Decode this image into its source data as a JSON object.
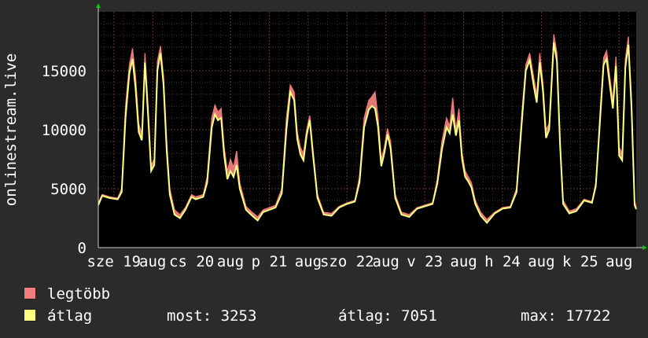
{
  "chart_data": {
    "type": "area",
    "ylabel": "onlinestream.live",
    "ylim": [
      0,
      20000
    ],
    "yticks": [
      0,
      5000,
      10000,
      15000
    ],
    "grid": true,
    "x_tick_labels": [
      {
        "label": "sze 19",
        "day": 0
      },
      {
        "label": "aug",
        "day": 0.5
      },
      {
        "label": "cs 20",
        "day": 1
      },
      {
        "label": "aug",
        "day": 1.5
      },
      {
        "label": "p 21",
        "day": 2
      },
      {
        "label": "aug",
        "day": 2.5
      },
      {
        "label": "szo 22",
        "day": 3
      },
      {
        "label": "aug",
        "day": 3.5
      },
      {
        "label": "v 23",
        "day": 4
      },
      {
        "label": "aug",
        "day": 4.5
      },
      {
        "label": "h 24",
        "day": 5
      },
      {
        "label": "aug",
        "day": 5.5
      },
      {
        "label": "k 25",
        "day": 6
      },
      {
        "label": "aug",
        "day": 6.5
      }
    ],
    "x_range_days": [
      -0.2,
      6.72
    ],
    "series": [
      {
        "name": "legtöbb",
        "color": "#f07c7c",
        "points": [
          [
            -0.2,
            3800
          ],
          [
            -0.15,
            4500
          ],
          [
            -0.05,
            4300
          ],
          [
            0.05,
            4200
          ],
          [
            0.1,
            5000
          ],
          [
            0.15,
            12000
          ],
          [
            0.2,
            15500
          ],
          [
            0.24,
            16900
          ],
          [
            0.28,
            14500
          ],
          [
            0.32,
            10500
          ],
          [
            0.36,
            9700
          ],
          [
            0.4,
            16500
          ],
          [
            0.44,
            12000
          ],
          [
            0.48,
            7000
          ],
          [
            0.52,
            7500
          ],
          [
            0.56,
            15800
          ],
          [
            0.6,
            17100
          ],
          [
            0.64,
            14500
          ],
          [
            0.68,
            9000
          ],
          [
            0.72,
            5000
          ],
          [
            0.78,
            3200
          ],
          [
            0.85,
            2800
          ],
          [
            0.92,
            3400
          ],
          [
            1.0,
            4500
          ],
          [
            1.05,
            4300
          ],
          [
            1.15,
            4500
          ],
          [
            1.2,
            6000
          ],
          [
            1.26,
            11000
          ],
          [
            1.3,
            12100
          ],
          [
            1.34,
            11500
          ],
          [
            1.38,
            11800
          ],
          [
            1.42,
            8500
          ],
          [
            1.46,
            6500
          ],
          [
            1.5,
            7500
          ],
          [
            1.54,
            6800
          ],
          [
            1.58,
            8200
          ],
          [
            1.62,
            5500
          ],
          [
            1.7,
            3500
          ],
          [
            1.78,
            3000
          ],
          [
            1.85,
            2600
          ],
          [
            1.92,
            3200
          ],
          [
            2.0,
            3400
          ],
          [
            2.08,
            3600
          ],
          [
            2.16,
            5000
          ],
          [
            2.22,
            11000
          ],
          [
            2.27,
            13800
          ],
          [
            2.32,
            13200
          ],
          [
            2.36,
            9800
          ],
          [
            2.4,
            8500
          ],
          [
            2.44,
            8000
          ],
          [
            2.48,
            10000
          ],
          [
            2.52,
            11200
          ],
          [
            2.56,
            8500
          ],
          [
            2.62,
            4500
          ],
          [
            2.7,
            3000
          ],
          [
            2.8,
            2900
          ],
          [
            2.9,
            3500
          ],
          [
            3.0,
            3800
          ],
          [
            3.1,
            4000
          ],
          [
            3.16,
            6000
          ],
          [
            3.22,
            11000
          ],
          [
            3.28,
            12500
          ],
          [
            3.32,
            12800
          ],
          [
            3.36,
            13200
          ],
          [
            3.4,
            11000
          ],
          [
            3.44,
            7500
          ],
          [
            3.48,
            8500
          ],
          [
            3.52,
            10100
          ],
          [
            3.56,
            9000
          ],
          [
            3.62,
            4500
          ],
          [
            3.7,
            3000
          ],
          [
            3.8,
            2800
          ],
          [
            3.9,
            3400
          ],
          [
            4.0,
            3600
          ],
          [
            4.1,
            3800
          ],
          [
            4.16,
            5800
          ],
          [
            4.22,
            9000
          ],
          [
            4.28,
            11000
          ],
          [
            4.32,
            10300
          ],
          [
            4.36,
            12700
          ],
          [
            4.4,
            10000
          ],
          [
            4.44,
            11800
          ],
          [
            4.48,
            8000
          ],
          [
            4.52,
            6500
          ],
          [
            4.56,
            6000
          ],
          [
            4.6,
            5500
          ],
          [
            4.65,
            4000
          ],
          [
            4.72,
            3000
          ],
          [
            4.8,
            2400
          ],
          [
            4.9,
            3000
          ],
          [
            5.0,
            3400
          ],
          [
            5.1,
            3500
          ],
          [
            5.18,
            5000
          ],
          [
            5.25,
            11500
          ],
          [
            5.3,
            15500
          ],
          [
            5.35,
            16500
          ],
          [
            5.4,
            14500
          ],
          [
            5.44,
            13000
          ],
          [
            5.48,
            16500
          ],
          [
            5.52,
            14000
          ],
          [
            5.56,
            10000
          ],
          [
            5.6,
            10500
          ],
          [
            5.66,
            18100
          ],
          [
            5.7,
            16500
          ],
          [
            5.74,
            9500
          ],
          [
            5.78,
            4000
          ],
          [
            5.86,
            3100
          ],
          [
            5.95,
            3300
          ],
          [
            6.05,
            4100
          ],
          [
            6.15,
            3900
          ],
          [
            6.2,
            5500
          ],
          [
            6.26,
            12000
          ],
          [
            6.3,
            16100
          ],
          [
            6.34,
            16700
          ],
          [
            6.38,
            14500
          ],
          [
            6.42,
            12500
          ],
          [
            6.46,
            16200
          ],
          [
            6.5,
            8500
          ],
          [
            6.54,
            8000
          ],
          [
            6.58,
            16000
          ],
          [
            6.62,
            17900
          ],
          [
            6.66,
            12500
          ],
          [
            6.7,
            4000
          ],
          [
            6.72,
            3400
          ]
        ]
      },
      {
        "name": "átlag",
        "color": "#ffff80",
        "points": [
          [
            -0.2,
            3600
          ],
          [
            -0.15,
            4400
          ],
          [
            -0.05,
            4200
          ],
          [
            0.05,
            4100
          ],
          [
            0.1,
            4700
          ],
          [
            0.15,
            11000
          ],
          [
            0.2,
            14800
          ],
          [
            0.24,
            16000
          ],
          [
            0.28,
            13500
          ],
          [
            0.32,
            9800
          ],
          [
            0.36,
            9100
          ],
          [
            0.4,
            15700
          ],
          [
            0.44,
            11200
          ],
          [
            0.48,
            6500
          ],
          [
            0.52,
            7000
          ],
          [
            0.56,
            15000
          ],
          [
            0.6,
            16500
          ],
          [
            0.64,
            13800
          ],
          [
            0.68,
            8200
          ],
          [
            0.72,
            4500
          ],
          [
            0.78,
            2800
          ],
          [
            0.85,
            2500
          ],
          [
            0.92,
            3200
          ],
          [
            1.0,
            4300
          ],
          [
            1.05,
            4100
          ],
          [
            1.15,
            4300
          ],
          [
            1.2,
            5500
          ],
          [
            1.26,
            10200
          ],
          [
            1.3,
            11300
          ],
          [
            1.34,
            10800
          ],
          [
            1.38,
            11000
          ],
          [
            1.42,
            7800
          ],
          [
            1.46,
            5800
          ],
          [
            1.5,
            6500
          ],
          [
            1.54,
            6000
          ],
          [
            1.58,
            7000
          ],
          [
            1.62,
            5000
          ],
          [
            1.7,
            3200
          ],
          [
            1.78,
            2700
          ],
          [
            1.85,
            2300
          ],
          [
            1.92,
            3000
          ],
          [
            2.0,
            3200
          ],
          [
            2.08,
            3400
          ],
          [
            2.16,
            4600
          ],
          [
            2.22,
            10000
          ],
          [
            2.27,
            13200
          ],
          [
            2.32,
            12500
          ],
          [
            2.36,
            9200
          ],
          [
            2.4,
            7900
          ],
          [
            2.44,
            7400
          ],
          [
            2.48,
            9500
          ],
          [
            2.52,
            10800
          ],
          [
            2.56,
            8000
          ],
          [
            2.62,
            4200
          ],
          [
            2.7,
            2800
          ],
          [
            2.8,
            2700
          ],
          [
            2.9,
            3400
          ],
          [
            3.0,
            3700
          ],
          [
            3.1,
            3900
          ],
          [
            3.16,
            5500
          ],
          [
            3.22,
            10200
          ],
          [
            3.28,
            11700
          ],
          [
            3.32,
            12000
          ],
          [
            3.36,
            11800
          ],
          [
            3.4,
            10200
          ],
          [
            3.44,
            6900
          ],
          [
            3.48,
            8000
          ],
          [
            3.52,
            9600
          ],
          [
            3.56,
            8400
          ],
          [
            3.62,
            4200
          ],
          [
            3.7,
            2800
          ],
          [
            3.8,
            2600
          ],
          [
            3.9,
            3300
          ],
          [
            4.0,
            3500
          ],
          [
            4.1,
            3700
          ],
          [
            4.16,
            5400
          ],
          [
            4.22,
            8300
          ],
          [
            4.28,
            10200
          ],
          [
            4.32,
            9700
          ],
          [
            4.36,
            11300
          ],
          [
            4.4,
            9500
          ],
          [
            4.44,
            10800
          ],
          [
            4.48,
            7500
          ],
          [
            4.52,
            6000
          ],
          [
            4.56,
            5600
          ],
          [
            4.6,
            5100
          ],
          [
            4.65,
            3700
          ],
          [
            4.72,
            2700
          ],
          [
            4.8,
            2100
          ],
          [
            4.9,
            2900
          ],
          [
            5.0,
            3300
          ],
          [
            5.1,
            3400
          ],
          [
            5.18,
            4700
          ],
          [
            5.25,
            10800
          ],
          [
            5.3,
            15000
          ],
          [
            5.35,
            15900
          ],
          [
            5.4,
            13800
          ],
          [
            5.44,
            12300
          ],
          [
            5.48,
            15700
          ],
          [
            5.52,
            13300
          ],
          [
            5.56,
            9300
          ],
          [
            5.6,
            10000
          ],
          [
            5.66,
            17400
          ],
          [
            5.7,
            15800
          ],
          [
            5.74,
            8800
          ],
          [
            5.78,
            3700
          ],
          [
            5.86,
            2900
          ],
          [
            5.95,
            3100
          ],
          [
            6.05,
            4000
          ],
          [
            6.15,
            3800
          ],
          [
            6.2,
            5200
          ],
          [
            6.26,
            11300
          ],
          [
            6.3,
            15500
          ],
          [
            6.34,
            16000
          ],
          [
            6.38,
            13800
          ],
          [
            6.42,
            11800
          ],
          [
            6.46,
            15400
          ],
          [
            6.5,
            7800
          ],
          [
            6.54,
            7400
          ],
          [
            6.58,
            15300
          ],
          [
            6.62,
            17200
          ],
          [
            6.66,
            11800
          ],
          [
            6.7,
            3600
          ],
          [
            6.72,
            3253
          ]
        ]
      }
    ]
  },
  "legend": [
    {
      "name": "legtöbb",
      "color": "#f07c7c"
    },
    {
      "name": "átlag",
      "color": "#ffff80"
    }
  ],
  "stats": {
    "now": "most: 3253",
    "avg": "átlag: 7051",
    "max": "max: 17722"
  }
}
